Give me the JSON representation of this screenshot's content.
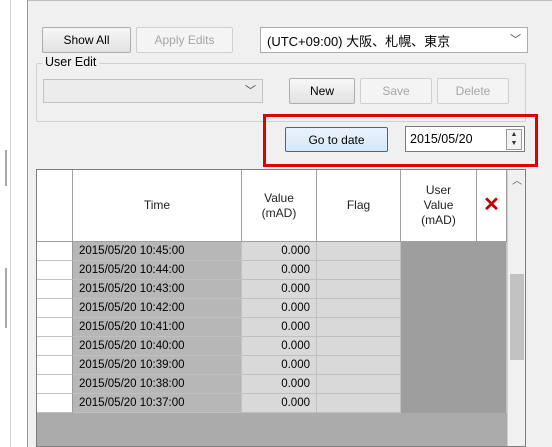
{
  "toolbar": {
    "show_all": "Show All",
    "apply_edits": "Apply Edits"
  },
  "timezone": {
    "value": "(UTC+09:00) 大阪、札幌、東京"
  },
  "user_edit": {
    "label": "User Edit",
    "combo_value": "",
    "new": "New",
    "save": "Save",
    "delete": "Delete"
  },
  "goto": {
    "button": "Go to date",
    "date_value": "2015/05/20"
  },
  "grid": {
    "headers": {
      "time": "Time",
      "value": "Value\n(mAD)",
      "flag": "Flag",
      "user_value": "User\nValue\n(mAD)",
      "delete_icon": "✕"
    },
    "rows": [
      {
        "time": "2015/05/20 10:45:00",
        "value": "0.000",
        "flag": ""
      },
      {
        "time": "2015/05/20 10:44:00",
        "value": "0.000",
        "flag": ""
      },
      {
        "time": "2015/05/20 10:43:00",
        "value": "0.000",
        "flag": ""
      },
      {
        "time": "2015/05/20 10:42:00",
        "value": "0.000",
        "flag": ""
      },
      {
        "time": "2015/05/20 10:41:00",
        "value": "0.000",
        "flag": ""
      },
      {
        "time": "2015/05/20 10:40:00",
        "value": "0.000",
        "flag": ""
      },
      {
        "time": "2015/05/20 10:39:00",
        "value": "0.000",
        "flag": ""
      },
      {
        "time": "2015/05/20 10:38:00",
        "value": "0.000",
        "flag": ""
      },
      {
        "time": "2015/05/20 10:37:00",
        "value": "0.000",
        "flag": ""
      }
    ]
  },
  "colors": {
    "highlight": "#e00000",
    "delete_icon": "#c00000",
    "focus": "#0078d7"
  }
}
